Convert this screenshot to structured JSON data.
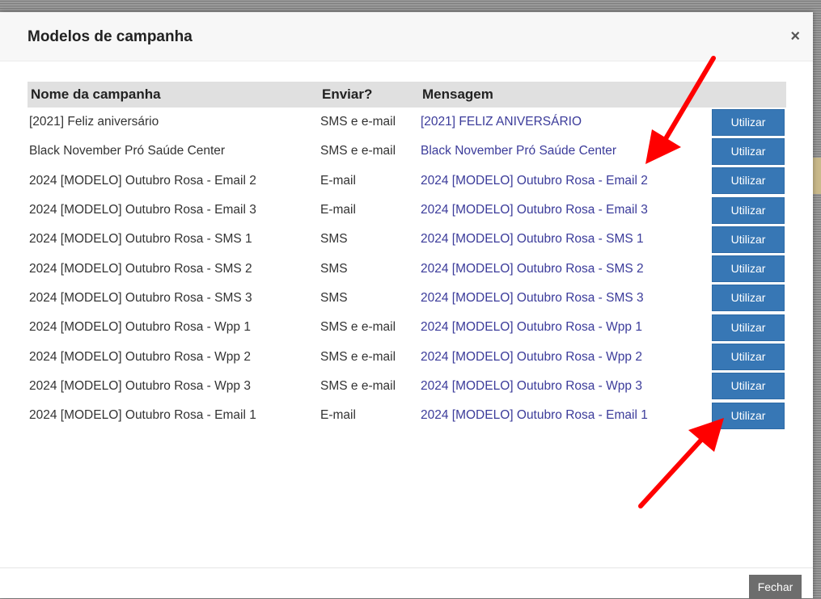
{
  "modal": {
    "title": "Modelos de campanha",
    "close_icon": "×",
    "footer_close_label": "Fechar"
  },
  "table": {
    "headers": [
      "Nome da campanha",
      "Enviar?",
      "Mensagem",
      ""
    ],
    "rows": [
      {
        "name": "[2021] Feliz aniversário",
        "send": "SMS e e-mail",
        "message": "[2021] FELIZ ANIVERSÁRIO",
        "action": "Utilizar"
      },
      {
        "name": "Black November Pró Saúde Center",
        "send": "SMS e e-mail",
        "message": "Black November Pró Saúde Center",
        "action": "Utilizar"
      },
      {
        "name": "2024 [MODELO] Outubro Rosa - Email 2",
        "send": "E-mail",
        "message": "2024 [MODELO] Outubro Rosa - Email 2",
        "action": "Utilizar"
      },
      {
        "name": "2024 [MODELO] Outubro Rosa - Email 3",
        "send": "E-mail",
        "message": "2024 [MODELO] Outubro Rosa - Email 3",
        "action": "Utilizar"
      },
      {
        "name": "2024 [MODELO] Outubro Rosa - SMS 1",
        "send": "SMS",
        "message": "2024 [MODELO] Outubro Rosa - SMS 1",
        "action": "Utilizar"
      },
      {
        "name": "2024 [MODELO] Outubro Rosa - SMS 2",
        "send": "SMS",
        "message": "2024 [MODELO] Outubro Rosa - SMS 2",
        "action": "Utilizar"
      },
      {
        "name": "2024 [MODELO] Outubro Rosa - SMS 3",
        "send": "SMS",
        "message": "2024 [MODELO] Outubro Rosa - SMS 3",
        "action": "Utilizar"
      },
      {
        "name": "2024 [MODELO] Outubro Rosa - Wpp 1",
        "send": "SMS e e-mail",
        "message": "2024 [MODELO] Outubro Rosa - Wpp 1",
        "action": "Utilizar"
      },
      {
        "name": "2024 [MODELO] Outubro Rosa - Wpp 2",
        "send": "SMS e e-mail",
        "message": "2024 [MODELO] Outubro Rosa - Wpp 2",
        "action": "Utilizar"
      },
      {
        "name": "2024 [MODELO] Outubro Rosa - Wpp 3",
        "send": "SMS e e-mail",
        "message": "2024 [MODELO] Outubro Rosa - Wpp 3",
        "action": "Utilizar"
      },
      {
        "name": "2024 [MODELO] Outubro Rosa - Email 1",
        "send": "E-mail",
        "message": "2024 [MODELO] Outubro Rosa - Email 1",
        "action": "Utilizar"
      }
    ]
  },
  "annotations": {
    "arrow_color": "#ff0000",
    "arrow_icons": [
      "arrow-pointing-to-email-2-icon",
      "arrow-pointing-to-email-1-button-icon"
    ]
  },
  "colors": {
    "primary_button": "#3777b5",
    "close_button": "#6d6d6d",
    "link_text": "#3b3b9a"
  }
}
